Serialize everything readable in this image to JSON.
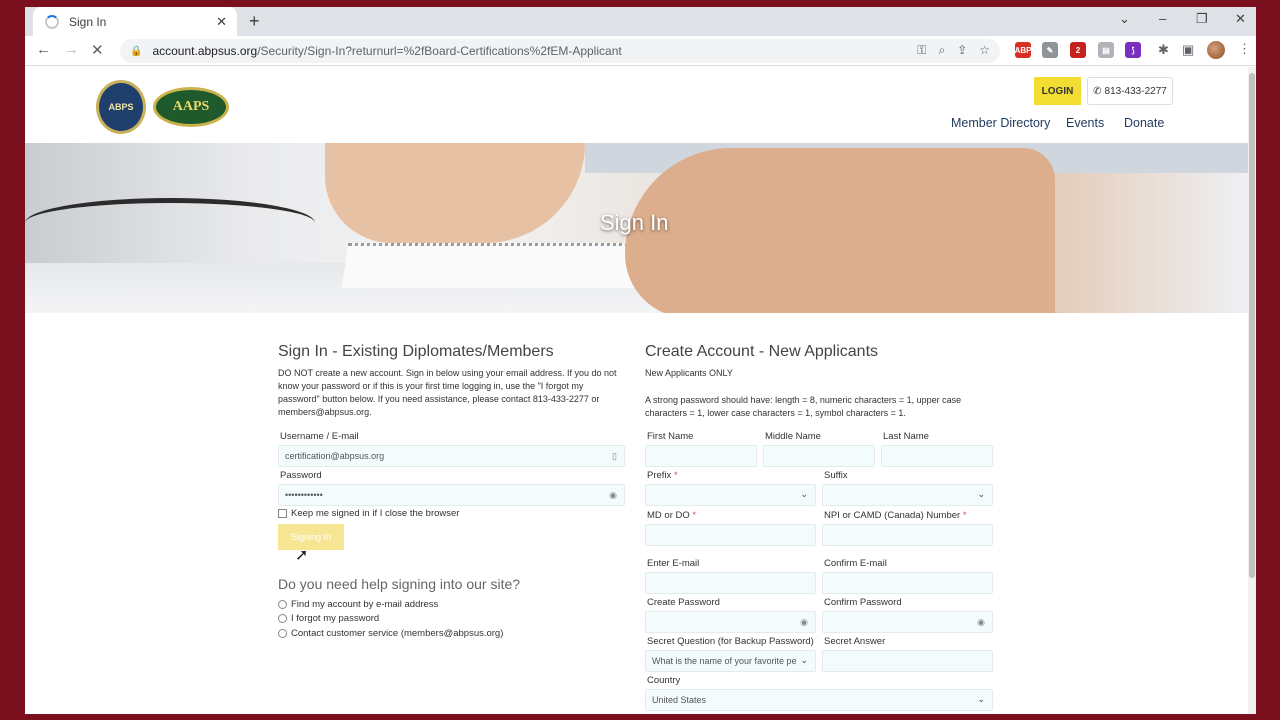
{
  "browser": {
    "tab_title": "Sign In",
    "new_tab": "+",
    "url_host": "account.abpsus.org",
    "url_path": "/Security/Sign-In?returnurl=%2fBoard-Certifications%2fEM-Applicant",
    "window_controls": [
      "⌄",
      "–",
      "❐",
      "✕"
    ],
    "extensions": [
      {
        "name": "abp-extension-icon",
        "label": "ABP",
        "color": "#d93025"
      },
      {
        "name": "reader-extension-icon",
        "label": "✎",
        "color": "#8f9499"
      },
      {
        "name": "badge-extension-icon",
        "label": "2",
        "color": "#c5221f"
      },
      {
        "name": "grey-extension-icon",
        "label": "▤",
        "color": "#b0b3b8"
      },
      {
        "name": "purple-extension-icon",
        "label": "⟆",
        "color": "#7b2fbf"
      }
    ]
  },
  "header": {
    "logo1_text": "ABPS",
    "logo2_text": "AAPS",
    "login_label": "LOGIN",
    "phone_label": "813-433-2277",
    "nav": [
      "Member Directory",
      "Events",
      "Donate"
    ]
  },
  "hero": {
    "title": "Sign In"
  },
  "signin": {
    "heading": "Sign In - Existing Diplomates/Members",
    "intro": "DO NOT create a new account. Sign in below using your email address. If you do not know your password or if this is your first time logging in, use the \"I forgot my password\" button below. If you need assistance, please contact 813-433-2277 or members@abpsus.org.",
    "username_label": "Username / E-mail",
    "username_value": "certification@abpsus.org",
    "password_label": "Password",
    "password_value": "••••••••••••",
    "keep_signed_in": "Keep me signed in if I close the browser",
    "button_label": "Signing In",
    "help_heading": "Do you need help signing into our site?",
    "help_options": [
      "Find my account by e-mail address",
      "I forgot my password",
      "Contact customer service (members@abpsus.org)"
    ]
  },
  "create": {
    "heading": "Create Account - New Applicants",
    "subhead": "New Applicants ONLY",
    "password_rules": "A strong password should have: length = 8, numeric characters = 1, upper case characters = 1, lower case characters = 1, symbol characters = 1.",
    "first_name": "First Name",
    "middle_name": "Middle Name",
    "last_name": "Last Name",
    "prefix": "Prefix",
    "suffix": "Suffix",
    "md_do": "MD or DO",
    "npi": "NPI or CAMD (Canada) Number",
    "email": "Enter E-mail",
    "confirm_email": "Confirm E-mail",
    "create_password": "Create Password",
    "confirm_password": "Confirm Password",
    "secret_question": "Secret Question (for Backup Password)",
    "secret_question_value": "What is the name of your favorite pe",
    "secret_answer": "Secret Answer",
    "country": "Country",
    "country_value": "United States",
    "required_mark": "*"
  }
}
